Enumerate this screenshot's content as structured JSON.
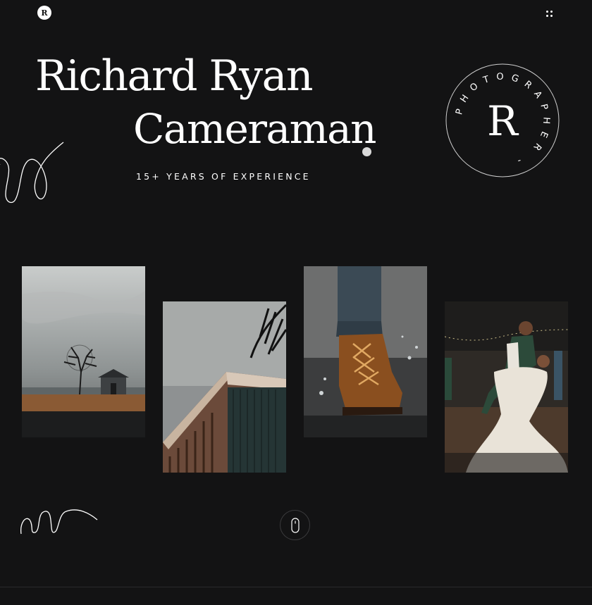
{
  "header": {
    "logo_letter": "R",
    "menu_icon": "grid-dots-icon"
  },
  "hero": {
    "name": "Richard Ryan",
    "role": "Cameraman",
    "experience": "15+ YEARS OF EXPERIENCE"
  },
  "badge": {
    "letter": "R",
    "ring_text": "PHOTOGRAPHER -"
  },
  "gallery": {
    "photos": [
      {
        "subject": "lone-tree-landscape"
      },
      {
        "subject": "modern-building-palm"
      },
      {
        "subject": "boot-splash"
      },
      {
        "subject": "wedding-dance"
      }
    ]
  },
  "scroll": {
    "icon": "mouse-icon"
  },
  "colors": {
    "background": "#131314",
    "text": "#ffffff",
    "muted_border": "#3a3a3c"
  }
}
